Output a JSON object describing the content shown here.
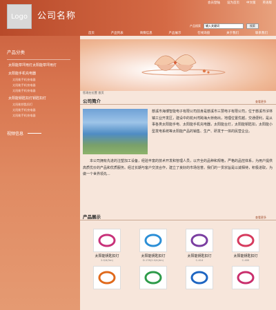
{
  "header": {
    "logo_text": "Logo",
    "company_name": "公司名称",
    "top_links": [
      "会员登陆",
      "设为首页",
      "中文版",
      "英语版"
    ],
    "search_label": "产品搜索",
    "search_value": "输入关键词",
    "search_button": "搜索"
  },
  "nav": [
    "首页",
    "产品列表",
    "商情信息",
    "产品展示",
    "在线询盘",
    "关于我们",
    "联系我们"
  ],
  "sidebar": {
    "title": "产品分类",
    "categories": [
      {
        "label": "太阳能草坪用灯太阳能草坪用灯",
        "subs": []
      },
      {
        "label": "太阳能手机充电器",
        "subs": [
          "太阳能手机充电器",
          "太阳能手机充电器",
          "太阳能手机充电器"
        ]
      },
      {
        "label": "太阳能钥匙扣灯钥匙扣灯",
        "subs": [
          "太阳能钥匙扣灯",
          "太阳能手机充电器",
          "太阳能手机充电器"
        ]
      }
    ],
    "video_title": "视频信息"
  },
  "breadcrumb": "您现在位置 首页",
  "about": {
    "title": "公司简介",
    "more": "查看更多",
    "text_side": "慈溪市海博智能电子有限公司前身是慈溪市三慧电子有限公司，位于慈溪市浒林镇工业开发区，建设中的杭州湾跨海大桥南出，地理位置优越，交通便利，是从事各类太阳能手电、太阳能手机充电器，太阳能台灯，太阳能钥匙扣，太阳能小型发电系统等太阳能产品的销售、生产、研发于一体的民营企业。",
    "text_full": "本公司拥有先进的注塑加工设备，经验丰富的技术开发和管理人员，以齐全的品种和规格，严格的品控体系，为用户提供高质优价的产品和优质服务。经过长期与客户交流合作，建立了良好的市场信誉。我们的一贯宗旨是以诚相待，积极进取，为做一个世界领先..."
  },
  "products": {
    "title": "产品展示",
    "more": "查看更多",
    "items": [
      {
        "name": "太阳能钥匙扣灯",
        "code": "2.0/4(5m)",
        "color": "#c8327a"
      },
      {
        "name": "太阳能钥匙扣灯",
        "code": "D-178(2.0/4(4m)",
        "color": "#2c8fd6"
      },
      {
        "name": "太阳能钥匙扣灯",
        "code": "C-414",
        "color": "#7a3ea1"
      },
      {
        "name": "太阳能钥匙扣灯",
        "code": "C-400",
        "color": "#d63b5e"
      },
      {
        "name": "",
        "code": "",
        "color": "#e06a1c"
      },
      {
        "name": "",
        "code": "",
        "color": "#2e9b4a"
      },
      {
        "name": "",
        "code": "",
        "color": "#1f66c2"
      },
      {
        "name": "",
        "code": "",
        "color": "#c92f6d"
      }
    ]
  }
}
